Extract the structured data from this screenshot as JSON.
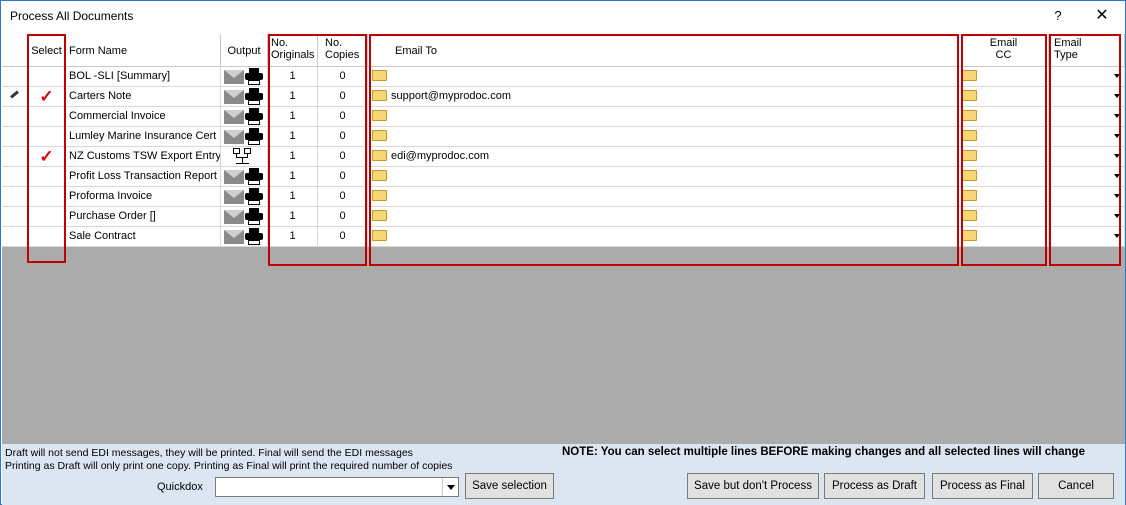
{
  "window": {
    "title": "Process All Documents",
    "help_label": "?",
    "close_label": "✕"
  },
  "columns": {
    "select": "Select",
    "form_name": "Form Name",
    "output": "Output",
    "originals_1": "No.",
    "originals_2": "Originals",
    "copies_1": "No.",
    "copies_2": "Copies",
    "email_to": "Email To",
    "email_cc_1": "Email",
    "email_cc_2": "CC",
    "email_type_1": "Email",
    "email_type_2": "Type"
  },
  "rows": [
    {
      "name": "BOL -SLI [Summary]",
      "selected": "",
      "output": "email-print",
      "originals": "1",
      "copies": "0",
      "email_to": ""
    },
    {
      "name": "Carters Note",
      "selected": "✓",
      "output": "email-print",
      "originals": "1",
      "copies": "0",
      "email_to": "support@myprodoc.com"
    },
    {
      "name": "Commercial Invoice",
      "selected": "",
      "output": "email-print",
      "originals": "1",
      "copies": "0",
      "email_to": ""
    },
    {
      "name": "Lumley Marine Insurance Cert",
      "selected": "",
      "output": "email-print",
      "originals": "1",
      "copies": "0",
      "email_to": ""
    },
    {
      "name": "NZ Customs TSW Export Entry",
      "selected": "✓",
      "output": "edi",
      "originals": "1",
      "copies": "0",
      "email_to": "edi@myprodoc.com"
    },
    {
      "name": "Profit Loss Transaction Report",
      "selected": "",
      "output": "email-print",
      "originals": "1",
      "copies": "0",
      "email_to": ""
    },
    {
      "name": "Proforma Invoice",
      "selected": "",
      "output": "email-print",
      "originals": "1",
      "copies": "0",
      "email_to": ""
    },
    {
      "name": "Purchase Order []",
      "selected": "",
      "output": "email-print",
      "originals": "1",
      "copies": "0",
      "email_to": ""
    },
    {
      "name": "Sale Contract",
      "selected": "",
      "output": "email-print",
      "originals": "1",
      "copies": "0",
      "email_to": ""
    }
  ],
  "footer": {
    "note1": "Draft will not send EDI messages, they will be printed.  Final will send the EDI messages",
    "note2": "Printing as Draft will only print one copy.  Printing as Final will print the required number of copies",
    "note_right": "NOTE:  You can select multiple lines BEFORE making changes and all selected lines will change",
    "quickdox_label": "Quickdox",
    "quickdox_value": "",
    "save_selection": "Save selection",
    "save_no_process": "Save but don't Process",
    "process_draft": "Process as Draft",
    "process_final": "Process as Final",
    "cancel": "Cancel"
  },
  "colors": {
    "highlight": "#c00000",
    "check": "#d9000f",
    "footer_bg": "#dce6f1",
    "grid_bg": "#ababab"
  }
}
